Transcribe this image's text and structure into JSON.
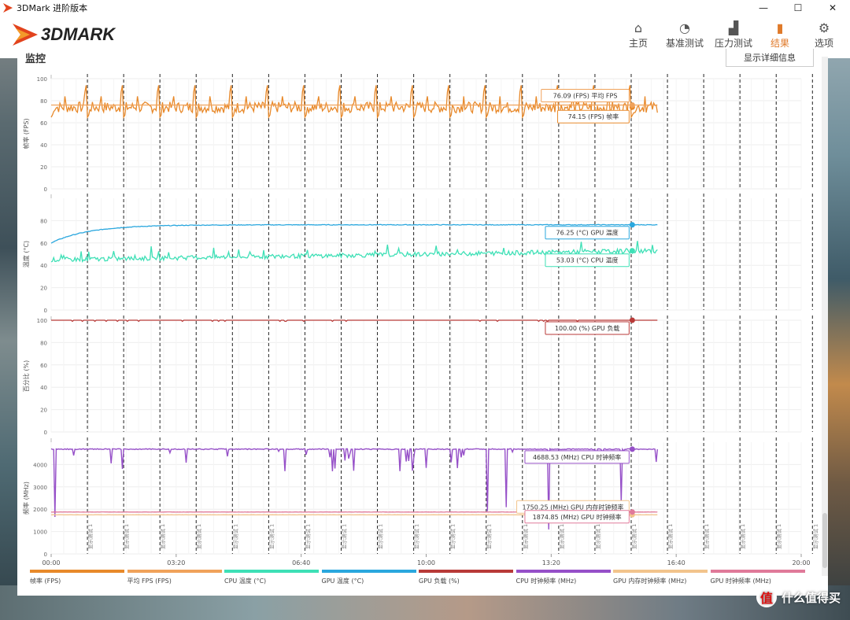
{
  "window": {
    "title": "3DMark 进阶版本",
    "minimize": "—",
    "maximize": "☐",
    "close": "✕"
  },
  "app": {
    "logo_text": "3DMARK"
  },
  "nav": [
    {
      "label": "主页",
      "icon": "⌂"
    },
    {
      "label": "基准测试",
      "icon": "◔"
    },
    {
      "label": "压力测试",
      "icon": "▟"
    },
    {
      "label": "结果",
      "icon": "▮"
    },
    {
      "label": "选项",
      "icon": "⚙"
    }
  ],
  "panel": {
    "title": "监控",
    "detail_button": "显示详细信息"
  },
  "chart_data": {
    "type": "line",
    "x_ticks": [
      "00:00",
      "03:20",
      "06:40",
      "10:00",
      "13:20",
      "16:40",
      "20:00"
    ],
    "x_range_seconds": [
      0,
      1200
    ],
    "marker_label": "显示测试 1",
    "marker_count": 21,
    "panels": [
      {
        "ylabel": "帧率 (FPS)",
        "y_ticks": [
          0,
          20,
          40,
          60,
          80,
          100
        ],
        "ylim": [
          0,
          100
        ],
        "series": [
          {
            "name": "帧率 (FPS)",
            "color": "#e8892a",
            "tooltip": "74.15 (FPS) 帧率",
            "current": 74.15,
            "base": 74,
            "spike": 100,
            "dip": 65
          },
          {
            "name": "平均 FPS (FPS)",
            "color": "#f0a25a",
            "tooltip": "76.09 (FPS) 平均 FPS",
            "current": 76.09
          }
        ]
      },
      {
        "ylabel": "温度 (°C)",
        "y_ticks": [
          0,
          20,
          40,
          60,
          80
        ],
        "ylim": [
          0,
          100
        ],
        "series": [
          {
            "name": "GPU 温度 (°C)",
            "color": "#2aa7de",
            "tooltip": "76.25 (°C) GPU 温度",
            "current": 76.25,
            "start": 60
          },
          {
            "name": "CPU 温度 (°C)",
            "color": "#3ee0b6",
            "tooltip": "53.03 (°C) CPU 温度",
            "current": 53.03,
            "start": 45
          }
        ]
      },
      {
        "ylabel": "百分比 (%)",
        "y_ticks": [
          0,
          20,
          40,
          60,
          80,
          100
        ],
        "ylim": [
          0,
          100
        ],
        "series": [
          {
            "name": "GPU 负载 (%)",
            "color": "#b83a38",
            "tooltip": "100.00 (%) GPU 负载",
            "current": 100.0
          }
        ]
      },
      {
        "ylabel": "频率 (MHz)",
        "y_ticks": [
          0,
          1000,
          2000,
          3000,
          4000
        ],
        "ylim": [
          0,
          5000
        ],
        "series": [
          {
            "name": "CPU 时钟频率 (MHz)",
            "color": "#9650c8",
            "tooltip": "4688.53 (MHz) CPU 时钟频率",
            "current": 4688.53
          },
          {
            "name": "GPU 内存时钟频率 (MHz)",
            "color": "#f2c48c",
            "tooltip": "1750.25 (MHz) GPU 内存时钟频率",
            "current": 1750.25
          },
          {
            "name": "GPU 时钟频率 (MHz)",
            "color": "#e07a9a",
            "tooltip": "1874.85 (MHz) GPU 时钟频率",
            "current": 1874.85
          }
        ]
      }
    ]
  },
  "legend": [
    {
      "label": "帧率 (FPS)",
      "color": "#e8892a"
    },
    {
      "label": "平均 FPS (FPS)",
      "color": "#f0a25a"
    },
    {
      "label": "CPU 温度 (°C)",
      "color": "#3ee0b6"
    },
    {
      "label": "GPU 温度 (°C)",
      "color": "#2aa7de"
    },
    {
      "label": "GPU 负载 (%)",
      "color": "#b83a38"
    },
    {
      "label": "CPU 时钟频率 (MHz)",
      "color": "#9650c8"
    },
    {
      "label": "GPU 内存时钟频率 (MHz)",
      "color": "#f2c48c"
    },
    {
      "label": "GPU 时钟频率 (MHz)",
      "color": "#e07a9a"
    }
  ],
  "watermark": {
    "icon": "值",
    "text": "什么值得买"
  }
}
